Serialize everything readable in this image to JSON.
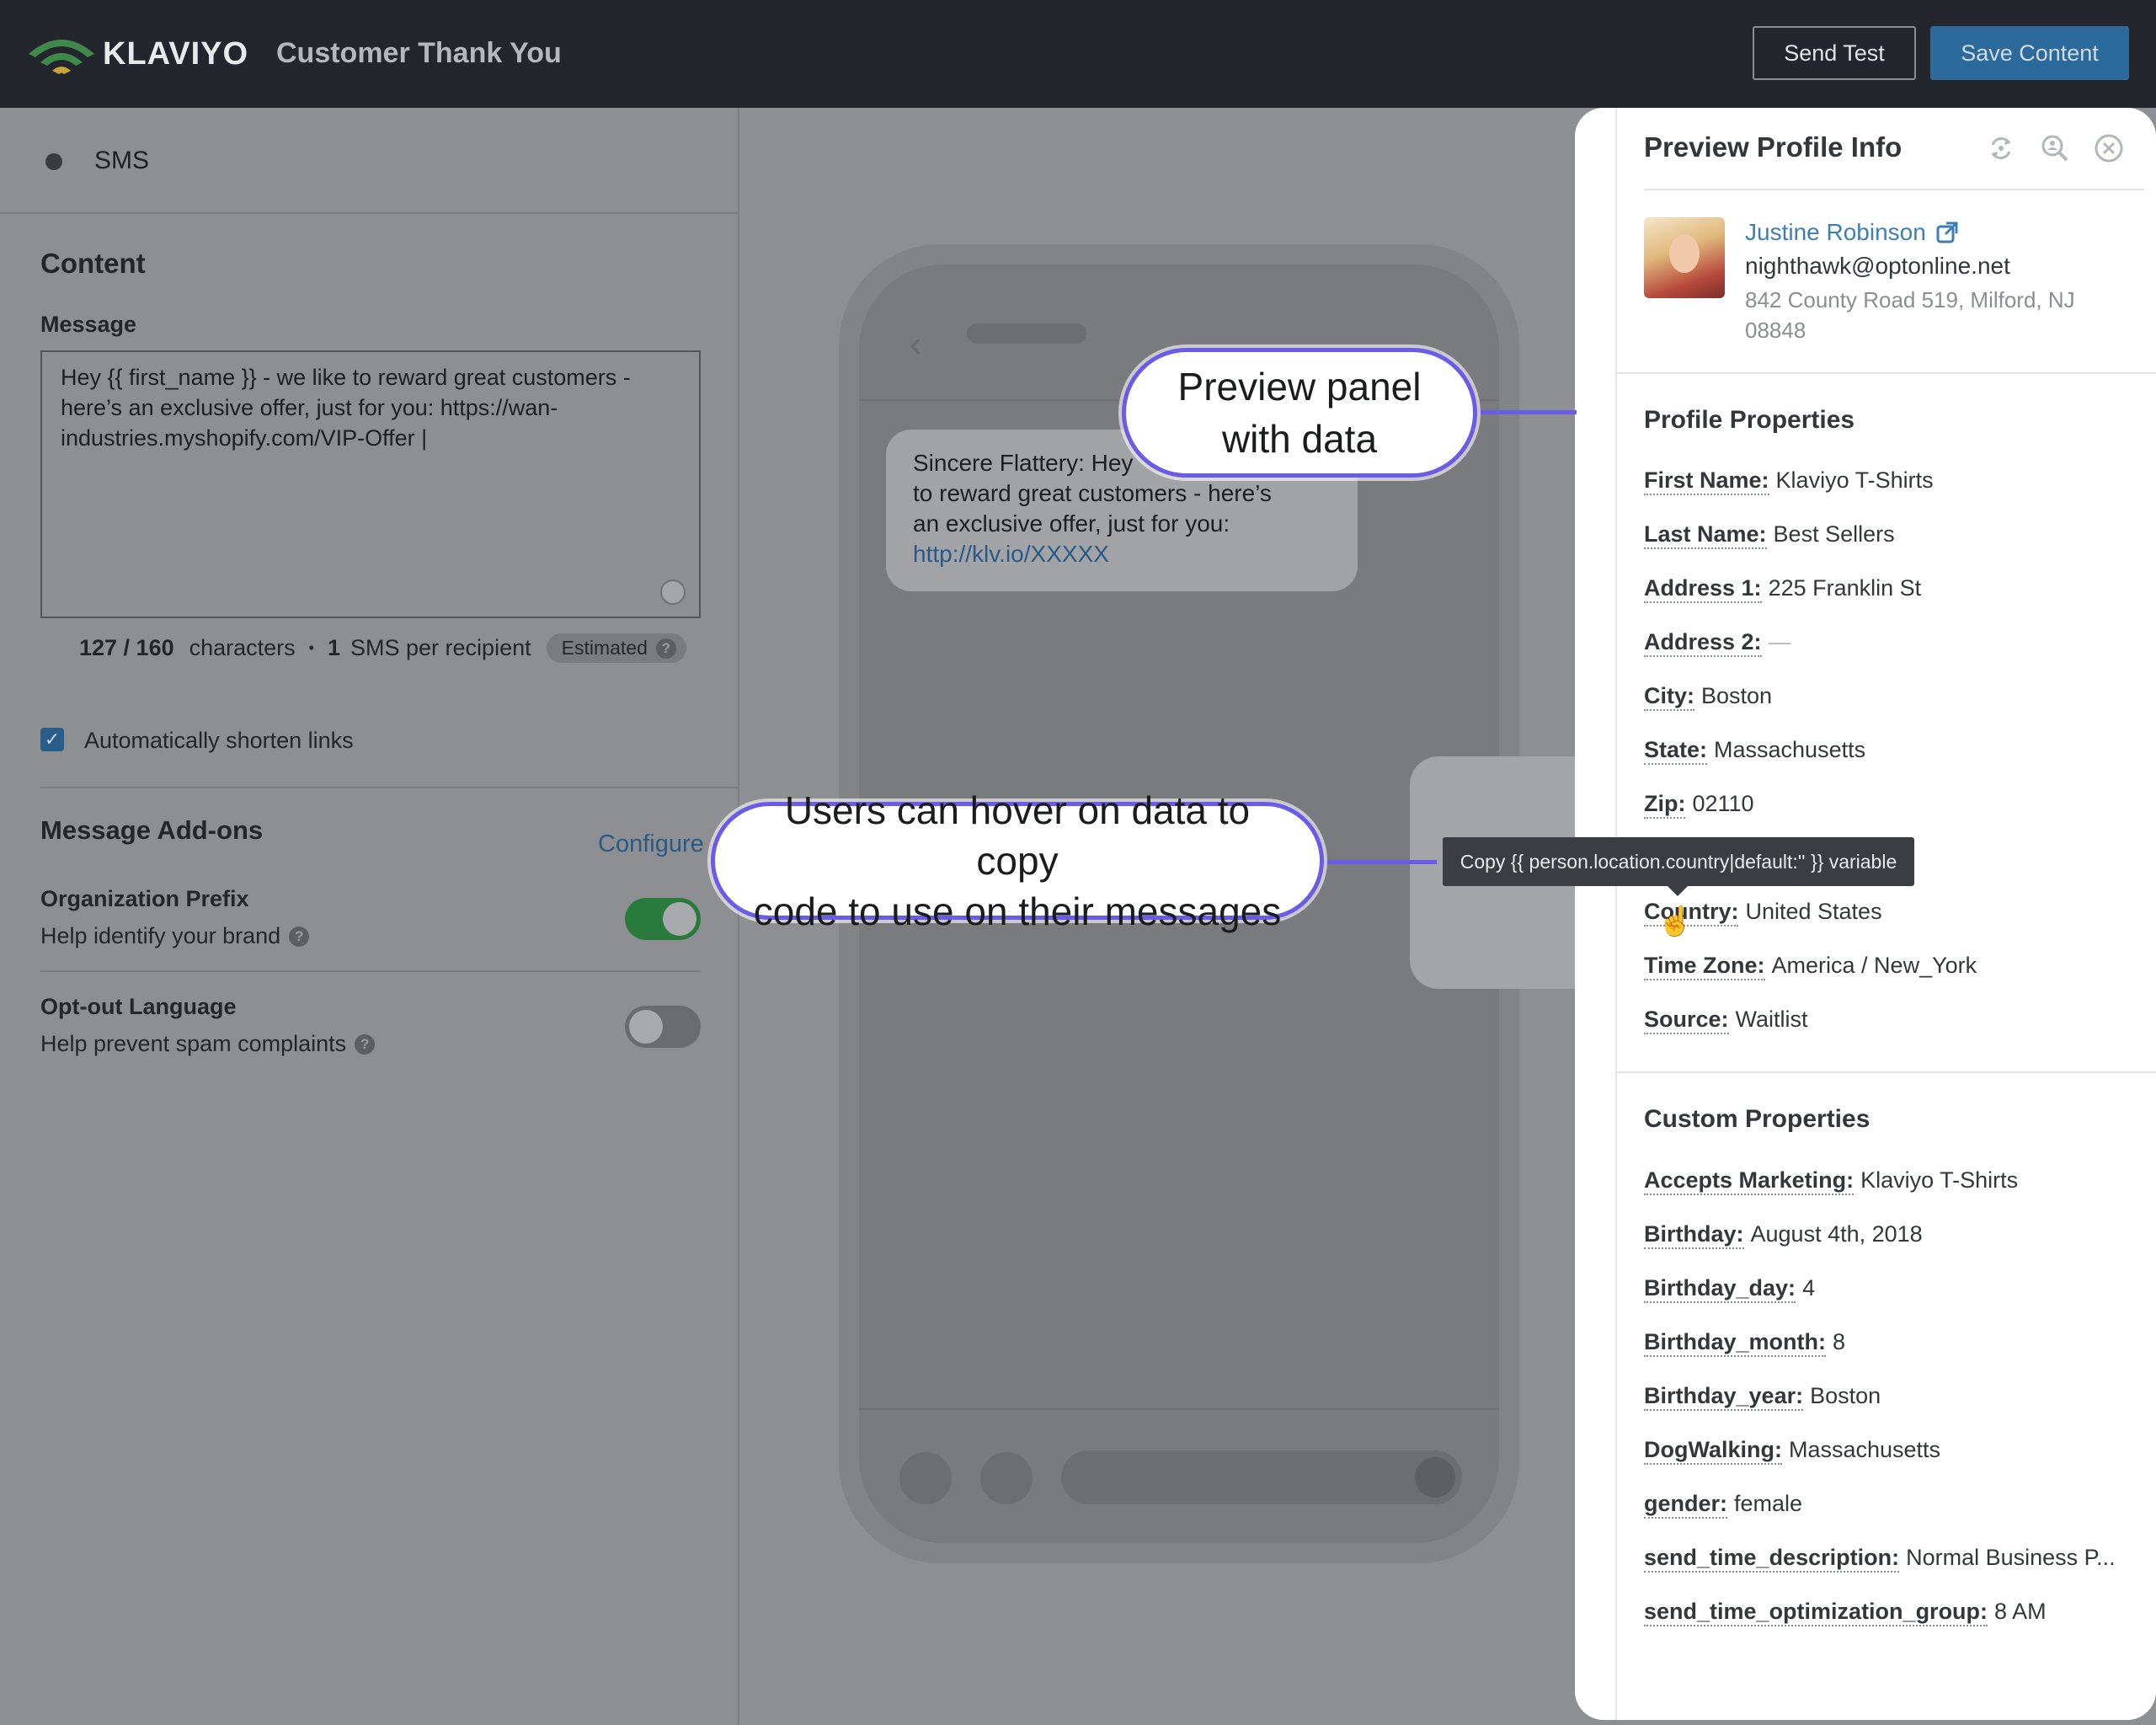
{
  "header": {
    "logo_text": "KLAVIYO",
    "title": "Customer Thank You",
    "send_test": "Send Test",
    "save_content": "Save Content"
  },
  "editor": {
    "channel": "SMS",
    "content_title": "Content",
    "message_label": "Message",
    "message_lines": [
      "Hey {{ first_name }} - we like to reward great customers -",
      "here’s an exclusive offer, just for you: https://wan-",
      "industries.myshopify.com/VIP-Offer |"
    ],
    "char_count": "127 / 160",
    "characters_label": "characters",
    "bullet": "•",
    "sms_count": "1",
    "sms_label": "SMS per recipient",
    "estimated": "Estimated",
    "shorten_links": "Automatically shorten links",
    "addons_title": "Message Add-ons",
    "configure": "Configure",
    "org_prefix_title": "Organization Prefix",
    "org_prefix_sub": "Help identify your brand",
    "org_prefix_on": true,
    "optout_title": "Opt-out Language",
    "optout_sub": "Help prevent spam complaints",
    "optout_on": false
  },
  "phone": {
    "bubble_lines": [
      "Sincere Flattery: Hey",
      "to reward great customers - here’s",
      "an exclusive offer, just for you:"
    ],
    "bubble_link": "http://klv.io/XXXXX"
  },
  "panel": {
    "title": "Preview Profile Info",
    "icons": [
      "refresh-icon",
      "search-profile-icon",
      "close-icon"
    ],
    "profile": {
      "name": "Justine Robinson",
      "email": "nighthawk@optonline.net",
      "address": "842 County Road 519, Milford, NJ 08848"
    },
    "profile_properties_title": "Profile Properties",
    "profile_properties": [
      {
        "k": "First Name:",
        "v": "Klaviyo T-Shirts"
      },
      {
        "k": "Last Name:",
        "v": "Best Sellers"
      },
      {
        "k": "Address 1:",
        "v": "225 Franklin St"
      },
      {
        "k": "Address 2:",
        "v": "—"
      },
      {
        "k": "City:",
        "v": "Boston"
      },
      {
        "k": "State:",
        "v": "Massachusetts"
      },
      {
        "k": "Zip:",
        "v": "02110"
      },
      {
        "k": "Country:",
        "v": "United States"
      },
      {
        "k": "Time Zone:",
        "v": "America / New_York"
      },
      {
        "k": "Source:",
        "v": "Waitlist"
      }
    ],
    "custom_properties_title": "Custom Properties",
    "custom_properties": [
      {
        "k": "Accepts Marketing:",
        "v": "Klaviyo T-Shirts"
      },
      {
        "k": "Birthday:",
        "v": "August 4th, 2018"
      },
      {
        "k": "Birthday_day:",
        "v": "4"
      },
      {
        "k": "Birthday_month:",
        "v": "8"
      },
      {
        "k": "Birthday_year:",
        "v": "Boston"
      },
      {
        "k": "DogWalking:",
        "v": "Massachusetts"
      },
      {
        "k": "gender:",
        "v": "female"
      },
      {
        "k": "send_time_description:",
        "v": "Normal Business P..."
      },
      {
        "k": "send_time_optimization_group:",
        "v": "8 AM"
      }
    ]
  },
  "tooltip": "Copy {{ person.location.country|default:'' }} variable",
  "callouts": {
    "preview_panel": [
      "Preview panel",
      "with data"
    ],
    "hover_copy": [
      "Users can hover on data to copy",
      "code to use on their messages"
    ]
  },
  "colors": {
    "topbar": "#23272d",
    "save_button": "#2c6a9c",
    "callout_border": "#6b5ce7",
    "link": "#3d7fb4",
    "toggle_on": "#2b7a3d"
  }
}
